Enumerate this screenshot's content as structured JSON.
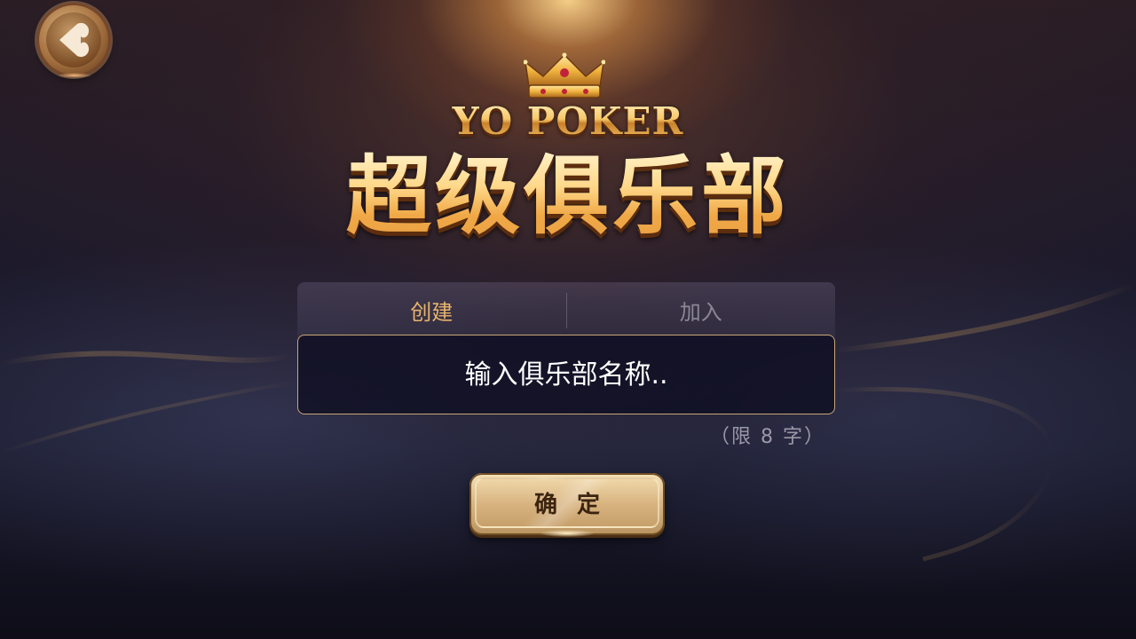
{
  "header": {
    "brand_text": "YO POKER",
    "title": "超级俱乐部"
  },
  "tabs": [
    {
      "label": "创建",
      "active": true
    },
    {
      "label": "加入",
      "active": false
    }
  ],
  "form": {
    "name_input_placeholder": "输入俱乐部名称..",
    "name_input_value": "",
    "limit_hint": "（限 8 字）",
    "confirm_label": "确定"
  },
  "icons": {
    "back": "back-spade-icon",
    "crown": "crown-icon"
  },
  "colors": {
    "accent_gold": "#e8b36b",
    "input_border": "#c9a774",
    "inactive_tab": "#8a8796",
    "hint_text": "#9b98a8"
  }
}
